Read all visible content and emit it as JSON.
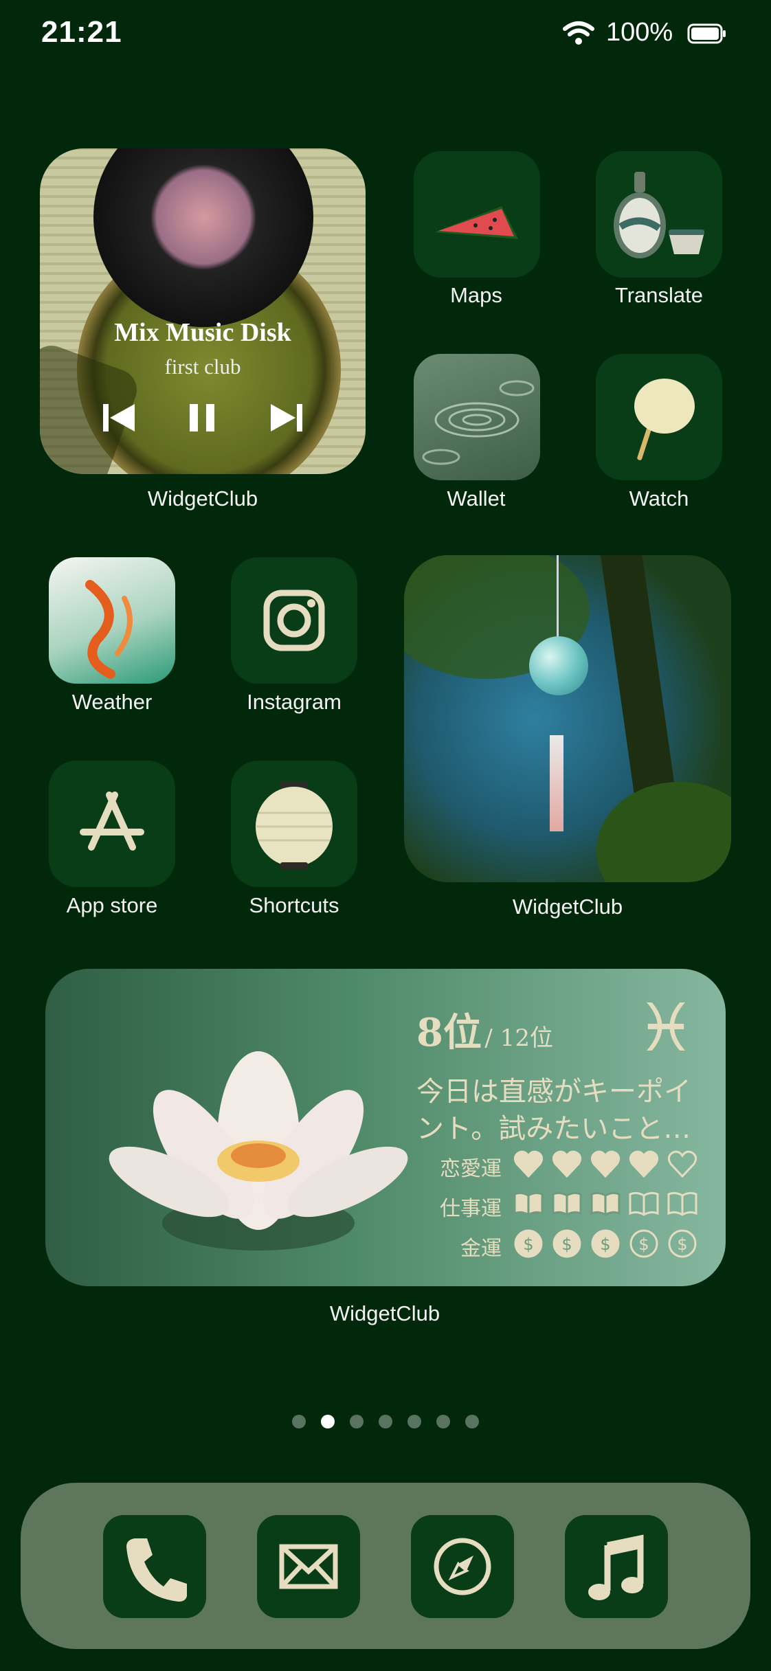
{
  "status_bar": {
    "time": "21:21",
    "battery": "100%"
  },
  "apps": {
    "maps": "Maps",
    "translate": "Translate",
    "wallet": "Wallet",
    "watch": "Watch",
    "weather": "Weather",
    "instagram": "Instagram",
    "app_store": "App store",
    "shortcuts": "Shortcuts"
  },
  "music_widget": {
    "title": "Mix Music Disk",
    "subtitle": "first club",
    "label": "WidgetClub"
  },
  "photo_widget": {
    "label": "WidgetClub"
  },
  "horoscope_widget": {
    "rank": "8位",
    "rank_total": "/ 12位",
    "sign_symbol": "♓",
    "message_line1": "今日は直感がキーポイ",
    "message_line2": "ント。試みたいこと…",
    "love_label": "恋愛運",
    "work_label": "仕事運",
    "money_label": "金運",
    "love_level": 4,
    "work_level": 3,
    "money_level": 3,
    "max_level": 5,
    "label": "WidgetClub"
  },
  "page_indicator": {
    "count": 7,
    "active_index": 1
  },
  "dock": [
    "phone-icon",
    "mail-icon",
    "compass-icon",
    "music-note-icon"
  ],
  "colors": {
    "background": "#02280c",
    "tile": "#083d18",
    "dock": "#5e775c",
    "accent": "#e6dcc0"
  }
}
